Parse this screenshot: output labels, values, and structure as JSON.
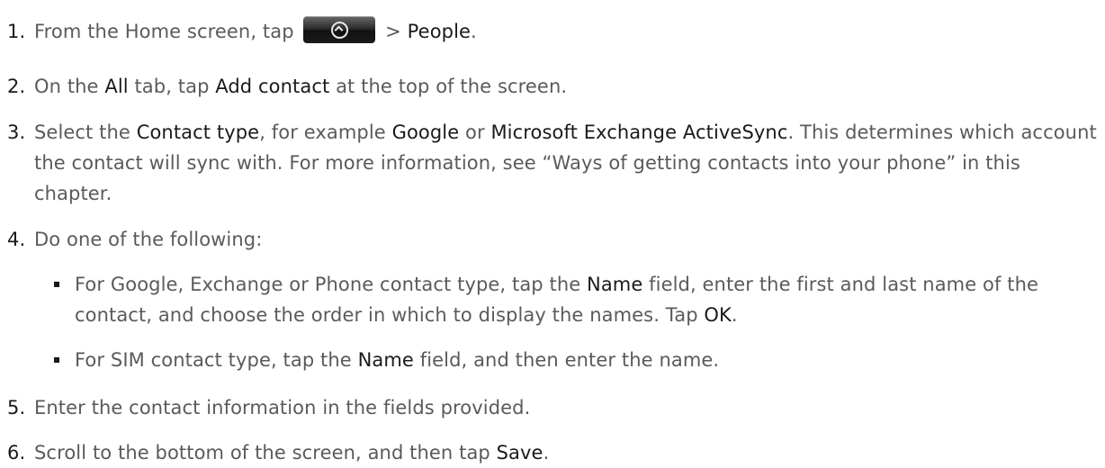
{
  "steps": [
    {
      "num": "1.",
      "parts": {
        "a": "From the Home screen, tap ",
        "b": " > ",
        "c": "People",
        "d": "."
      }
    },
    {
      "num": "2.",
      "parts": {
        "a": "On the ",
        "b": "All",
        "c": " tab, tap ",
        "d": "Add contact",
        "e": " at the top of the screen."
      }
    },
    {
      "num": "3.",
      "parts": {
        "a": "Select the ",
        "b": "Contact type",
        "c": ", for example ",
        "d": "Google",
        "e": " or ",
        "f": "Microsoft Exchange ActiveSync",
        "g": ". This determines which account the contact will sync with. For more information, see “Ways of getting contacts into your phone” in this chapter."
      }
    },
    {
      "num": "4.",
      "parts": {
        "a": "Do one of the following:"
      },
      "subitems": [
        {
          "a": "For Google, Exchange or Phone contact type, tap the ",
          "b": "Name",
          "c": " field, enter the first and last name of the contact, and choose the order in which to display the names. Tap ",
          "d": "OK",
          "e": "."
        },
        {
          "a": "For SIM contact type, tap the ",
          "b": "Name",
          "c": " field, and then enter the name."
        }
      ]
    },
    {
      "num": "5.",
      "parts": {
        "a": "Enter the contact information in the fields provided."
      }
    },
    {
      "num": "6.",
      "parts": {
        "a": "Scroll to the bottom of the screen, and then tap ",
        "b": "Save",
        "c": "."
      }
    }
  ],
  "icons": {
    "home_button": "home-up-arrow-icon"
  },
  "colors": {
    "body_text": "#5a5a5a",
    "emphasis_text": "#1a1a1a"
  }
}
